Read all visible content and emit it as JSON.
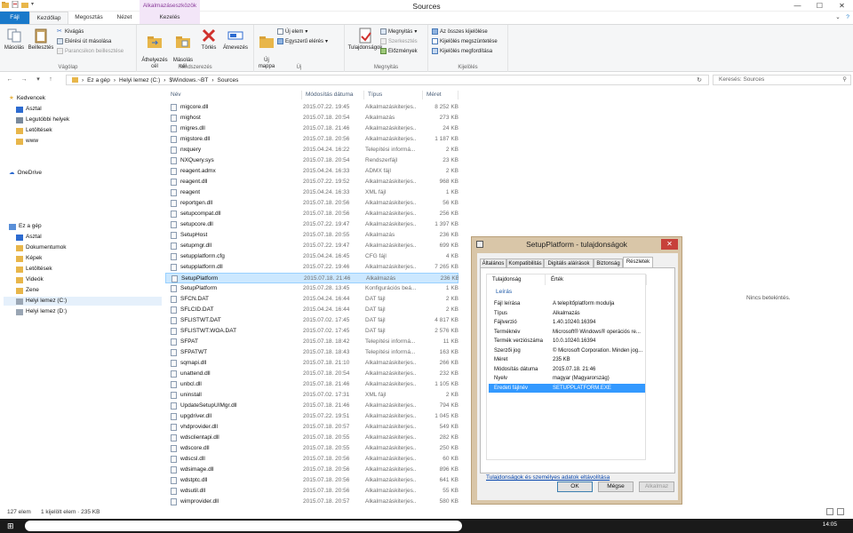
{
  "window": {
    "title": "Sources",
    "context_label": "Alkalmazáseszközök",
    "min": "—",
    "max": "☐",
    "close": "✕"
  },
  "tabs": {
    "file": "Fájl",
    "home": "Kezdőlap",
    "share": "Megosztás",
    "view": "Nézet",
    "manage": "Kezelés"
  },
  "ribbon": {
    "copy": "Másolás",
    "paste": "Beillesztés",
    "cut": "Kivágás",
    "copy_path": "Elérési út másolása",
    "paste_shortcut": "Parancsikon beillesztése",
    "clipboard_group": "Vágólap",
    "move_to": "Áthelyezés\ncél",
    "copy_to": "Másolás\ncél",
    "delete": "Törlés",
    "rename": "Átnevezés",
    "organize_group": "Rendszerezés",
    "new_folder": "Új\nmappa",
    "new_item": "Új elem",
    "easy_access": "Egyszerű elérés",
    "new_group": "Új",
    "properties": "Tulajdonságok",
    "open": "Megnyitás",
    "edit": "Szerkesztés",
    "history": "Előzmények",
    "open_group": "Megnyitás",
    "select_all": "Az összes kijelölése",
    "select_none": "Kijelölés megszüntetése",
    "invert": "Kijelölés megfordítása",
    "select_group": "Kijelölés"
  },
  "address": {
    "parts": [
      "Ez a gép",
      "Helyi lemez (C:)",
      "$Windows.~BT",
      "Sources"
    ],
    "search_placeholder": "Keresés: Sources"
  },
  "nav": {
    "favorites": "Kedvencek",
    "desktop": "Asztal",
    "recent": "Legutóbbi helyek",
    "downloads": "Letöltések",
    "www": "www",
    "onedrive": "OneDrive",
    "thispc": "Ez a gép",
    "pc_desktop": "Asztal",
    "documents": "Dokumentumok",
    "pictures": "Képek",
    "pc_downloads": "Letöltések",
    "videos": "Videók",
    "music": "Zene",
    "disk_c": "Helyi lemez (C:)",
    "disk_d": "Helyi lemez (D:)"
  },
  "columns": {
    "name": "Név",
    "date": "Módosítás dátuma",
    "type": "Típus",
    "size": "Méret"
  },
  "files": [
    {
      "name": "migcore.dll",
      "date": "2015.07.22. 19:45",
      "type": "Alkalmazáskiterjes...",
      "size": "8 252 KB"
    },
    {
      "name": "mighost",
      "date": "2015.07.18. 20:54",
      "type": "Alkalmazás",
      "size": "273 KB"
    },
    {
      "name": "migres.dll",
      "date": "2015.07.18. 21:46",
      "type": "Alkalmazáskiterjes...",
      "size": "24 KB"
    },
    {
      "name": "migstore.dll",
      "date": "2015.07.18. 20:56",
      "type": "Alkalmazáskiterjes...",
      "size": "1 187 KB"
    },
    {
      "name": "nxquery",
      "date": "2015.04.24. 16:22",
      "type": "Telepítési informá...",
      "size": "2 KB"
    },
    {
      "name": "NXQuery.sys",
      "date": "2015.07.18. 20:54",
      "type": "Rendszerfájl",
      "size": "23 KB"
    },
    {
      "name": "reagent.admx",
      "date": "2015.04.24. 16:33",
      "type": "ADMX fájl",
      "size": "2 KB"
    },
    {
      "name": "reagent.dll",
      "date": "2015.07.22. 19:52",
      "type": "Alkalmazáskiterjes...",
      "size": "968 KB"
    },
    {
      "name": "reagent",
      "date": "2015.04.24. 16:33",
      "type": "XML fájl",
      "size": "1 KB"
    },
    {
      "name": "reportgen.dll",
      "date": "2015.07.18. 20:56",
      "type": "Alkalmazáskiterjes...",
      "size": "56 KB"
    },
    {
      "name": "setupcompat.dll",
      "date": "2015.07.18. 20:56",
      "type": "Alkalmazáskiterjes...",
      "size": "256 KB"
    },
    {
      "name": "setupcore.dll",
      "date": "2015.07.22. 19:47",
      "type": "Alkalmazáskiterjes...",
      "size": "1 397 KB"
    },
    {
      "name": "SetupHost",
      "date": "2015.07.18. 20:55",
      "type": "Alkalmazás",
      "size": "236 KB"
    },
    {
      "name": "setupmgr.dll",
      "date": "2015.07.22. 19:47",
      "type": "Alkalmazáskiterjes...",
      "size": "699 KB"
    },
    {
      "name": "setupplatform.cfg",
      "date": "2015.04.24. 16:45",
      "type": "CFG fájl",
      "size": "4 KB"
    },
    {
      "name": "setupplatform.dll",
      "date": "2015.07.22. 19:46",
      "type": "Alkalmazáskiterjes...",
      "size": "7 265 KB"
    },
    {
      "name": "SetupPlatform",
      "date": "2015.07.18. 21:46",
      "type": "Alkalmazás",
      "size": "236 KB",
      "selected": true
    },
    {
      "name": "SetupPlatform",
      "date": "2015.07.28. 13:45",
      "type": "Konfigurációs beá...",
      "size": "1 KB"
    },
    {
      "name": "SFCN.DAT",
      "date": "2015.04.24. 16:44",
      "type": "DAT fájl",
      "size": "2 KB"
    },
    {
      "name": "SFLCID.DAT",
      "date": "2015.04.24. 16:44",
      "type": "DAT fájl",
      "size": "2 KB"
    },
    {
      "name": "SFLISTWT.DAT",
      "date": "2015.07.02. 17:45",
      "type": "DAT fájl",
      "size": "4 817 KB"
    },
    {
      "name": "SFLISTWT.WOA.DAT",
      "date": "2015.07.02. 17:45",
      "type": "DAT fájl",
      "size": "2 576 KB"
    },
    {
      "name": "SFPAT",
      "date": "2015.07.18. 18:42",
      "type": "Telepítési informá...",
      "size": "11 KB"
    },
    {
      "name": "SFPATWT",
      "date": "2015.07.18. 18:43",
      "type": "Telepítési informá...",
      "size": "163 KB"
    },
    {
      "name": "sqmapi.dll",
      "date": "2015.07.18. 21:10",
      "type": "Alkalmazáskiterjes...",
      "size": "266 KB"
    },
    {
      "name": "unattend.dll",
      "date": "2015.07.18. 20:54",
      "type": "Alkalmazáskiterjes...",
      "size": "232 KB"
    },
    {
      "name": "unbcl.dll",
      "date": "2015.07.18. 21:46",
      "type": "Alkalmazáskiterjes...",
      "size": "1 105 KB"
    },
    {
      "name": "uninstall",
      "date": "2015.07.02. 17:31",
      "type": "XML fájl",
      "size": "2 KB"
    },
    {
      "name": "UpdateSetupUIMgr.dll",
      "date": "2015.07.18. 21:46",
      "type": "Alkalmazáskiterjes...",
      "size": "794 KB"
    },
    {
      "name": "upgdriver.dll",
      "date": "2015.07.22. 19:51",
      "type": "Alkalmazáskiterjes...",
      "size": "1 045 KB"
    },
    {
      "name": "vhdprovider.dll",
      "date": "2015.07.18. 20:57",
      "type": "Alkalmazáskiterjes...",
      "size": "549 KB"
    },
    {
      "name": "wdsclientapi.dll",
      "date": "2015.07.18. 20:55",
      "type": "Alkalmazáskiterjes...",
      "size": "282 KB"
    },
    {
      "name": "wdscore.dll",
      "date": "2015.07.18. 20:55",
      "type": "Alkalmazáskiterjes...",
      "size": "250 KB"
    },
    {
      "name": "wdscsl.dll",
      "date": "2015.07.18. 20:56",
      "type": "Alkalmazáskiterjes...",
      "size": "60 KB"
    },
    {
      "name": "wdsimage.dll",
      "date": "2015.07.18. 20:56",
      "type": "Alkalmazáskiterjes...",
      "size": "896 KB"
    },
    {
      "name": "wdstptc.dll",
      "date": "2015.07.18. 20:56",
      "type": "Alkalmazáskiterjes...",
      "size": "641 KB"
    },
    {
      "name": "wdsutil.dll",
      "date": "2015.07.18. 20:56",
      "type": "Alkalmazáskiterjes...",
      "size": "55 KB"
    },
    {
      "name": "wimprovider.dll",
      "date": "2015.07.18. 20:57",
      "type": "Alkalmazáskiterjes...",
      "size": "580 KB"
    }
  ],
  "preview": "Nincs betekintés.",
  "status": {
    "count": "127 elem",
    "selection": "1 kijelölt elem · 235 KB"
  },
  "taskbar": {
    "clock": "14:05"
  },
  "dialog": {
    "title": "SetupPlatform - tulajdonságok",
    "tabs": [
      "Általános",
      "Kompatibilitás",
      "Digitális aláírások",
      "Biztonság",
      "Részletek"
    ],
    "col_prop": "Tulajdonság",
    "col_val": "Érték",
    "section": "Leírás",
    "rows": [
      {
        "k": "Fájl leírása",
        "v": "A telepítőplatform modulja"
      },
      {
        "k": "Típus",
        "v": "Alkalmazás"
      },
      {
        "k": "Fájlverzió",
        "v": "1.40.10240.16394"
      },
      {
        "k": "Terméknév",
        "v": "Microsoft® Windows® operációs re..."
      },
      {
        "k": "Termék verziószáma",
        "v": "10.0.10240.16394"
      },
      {
        "k": "Szerzői jog",
        "v": "© Microsoft Corporation. Minden jog..."
      },
      {
        "k": "Méret",
        "v": "235 KB"
      },
      {
        "k": "Módosítás dátuma",
        "v": "2015.07.18. 21:46"
      },
      {
        "k": "Nyelv",
        "v": "magyar (Magyarország)"
      },
      {
        "k": "Eredeti fájlnév",
        "v": "SETUPPLATFORM.EXE",
        "selected": true
      }
    ],
    "link": "Tulajdonságok és személyes adatok eltávolítása",
    "ok": "OK",
    "cancel": "Mégse",
    "apply": "Alkalmaz"
  }
}
